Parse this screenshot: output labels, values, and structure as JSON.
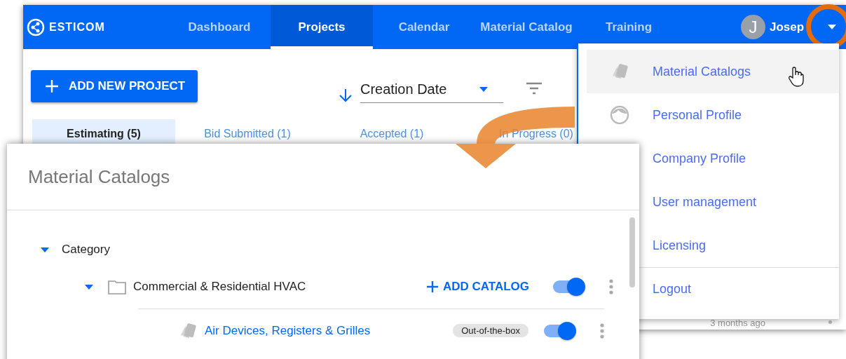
{
  "app": {
    "logo": "ESTICOM",
    "nav": [
      {
        "label": "Dashboard",
        "selected": false
      },
      {
        "label": "Projects",
        "selected": true
      },
      {
        "label": "Calendar",
        "selected": false
      },
      {
        "label": "Material Catalog",
        "selected": false
      },
      {
        "label": "Training",
        "selected": false
      }
    ],
    "user": {
      "initial": "J",
      "name": "Josep"
    },
    "add_button": "ADD NEW PROJECT",
    "sort": {
      "value": "Creation Date"
    },
    "status_tabs": [
      {
        "label": "Estimating (5)",
        "selected": true
      },
      {
        "label": "Bid Submitted (1)",
        "selected": false
      },
      {
        "label": "Accepted (1)",
        "selected": false
      },
      {
        "label": "In Progress (0)",
        "selected": false
      }
    ],
    "row_time": "3 months ago"
  },
  "user_menu": {
    "items": [
      {
        "label": "Material Catalogs",
        "kind": "catalog",
        "hovered": true
      },
      {
        "label": "Personal Profile",
        "kind": "profile",
        "hovered": false
      },
      {
        "label": "Company Profile",
        "kind": "plain",
        "hovered": false
      },
      {
        "label": "User management",
        "kind": "plain",
        "hovered": false
      },
      {
        "label": "Licensing",
        "kind": "plain",
        "hovered": false
      },
      {
        "label": "Logout",
        "kind": "logout",
        "hovered": false
      }
    ]
  },
  "catalog_panel": {
    "title": "Material Catalogs",
    "tree": [
      {
        "label": "Category",
        "expanded": true,
        "children": [
          {
            "label": "Commercial & Residential HVAC",
            "expanded": true,
            "action": "ADD CATALOG",
            "on": true,
            "children": [
              {
                "label": "Air Devices, Registers & Grilles",
                "badge": "Out-of-the-box",
                "on": true
              }
            ]
          }
        ]
      }
    ]
  }
}
